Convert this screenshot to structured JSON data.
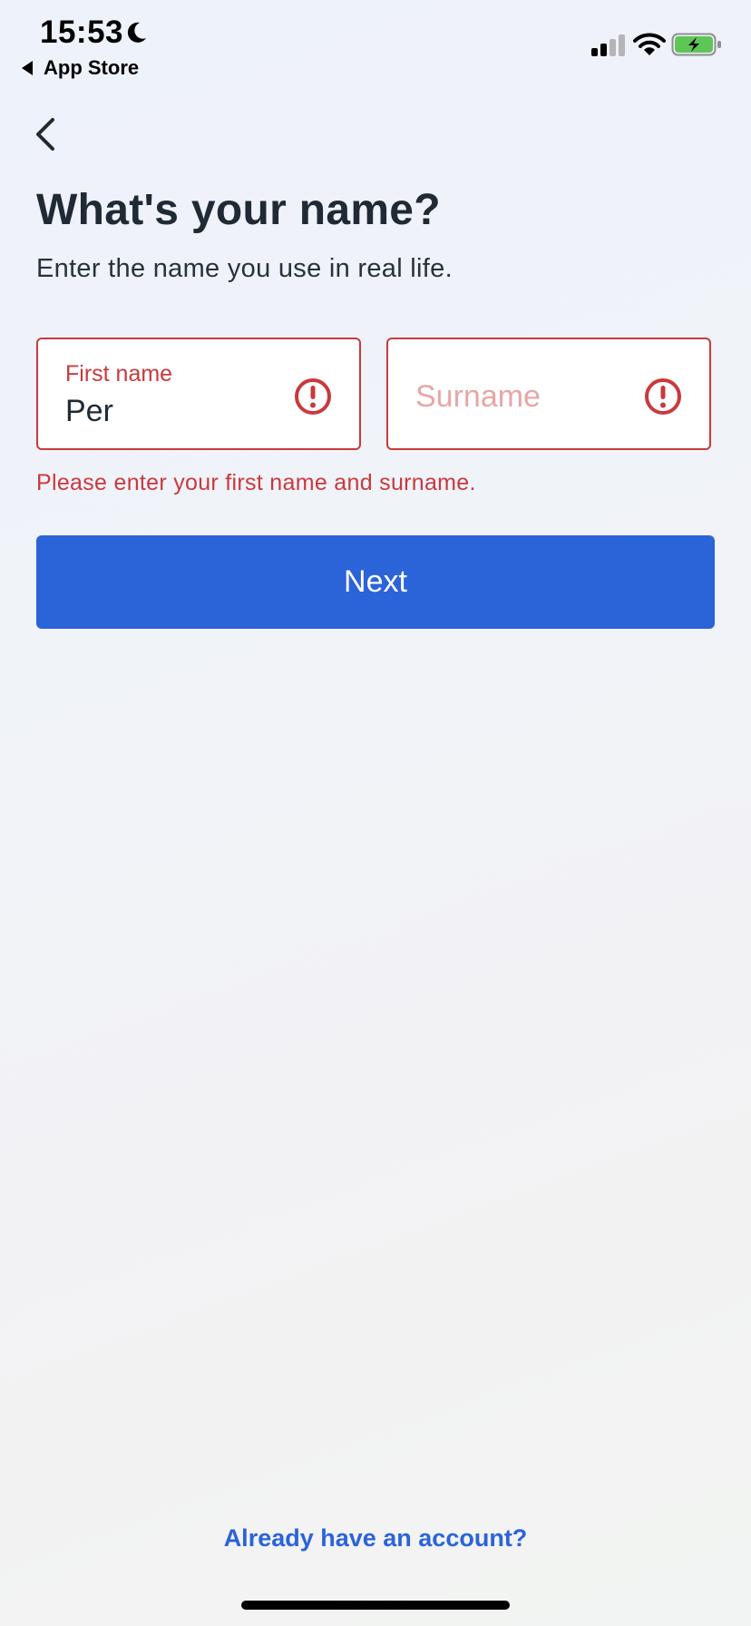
{
  "status_bar": {
    "time": "15:53",
    "back_app_label": "App Store",
    "icons": [
      "moon-icon",
      "cellular-signal-icon",
      "wifi-icon",
      "battery-charging-icon"
    ]
  },
  "header": {
    "back_icon": "chevron-left-icon",
    "title": "What's your name?",
    "subtitle": "Enter the name you use in real life."
  },
  "form": {
    "first_name": {
      "label": "First name",
      "value": "Per",
      "state": "error",
      "icon": "alert-circle-icon"
    },
    "surname": {
      "placeholder": "Surname",
      "value": "",
      "state": "error",
      "icon": "alert-circle-icon"
    },
    "error_message": "Please enter your first name and surname.",
    "next_label": "Next"
  },
  "footer": {
    "account_link": "Already have an account?"
  },
  "colors": {
    "accent": "#2b63d9",
    "error": "#c9393d",
    "text": "#1f2a35"
  }
}
